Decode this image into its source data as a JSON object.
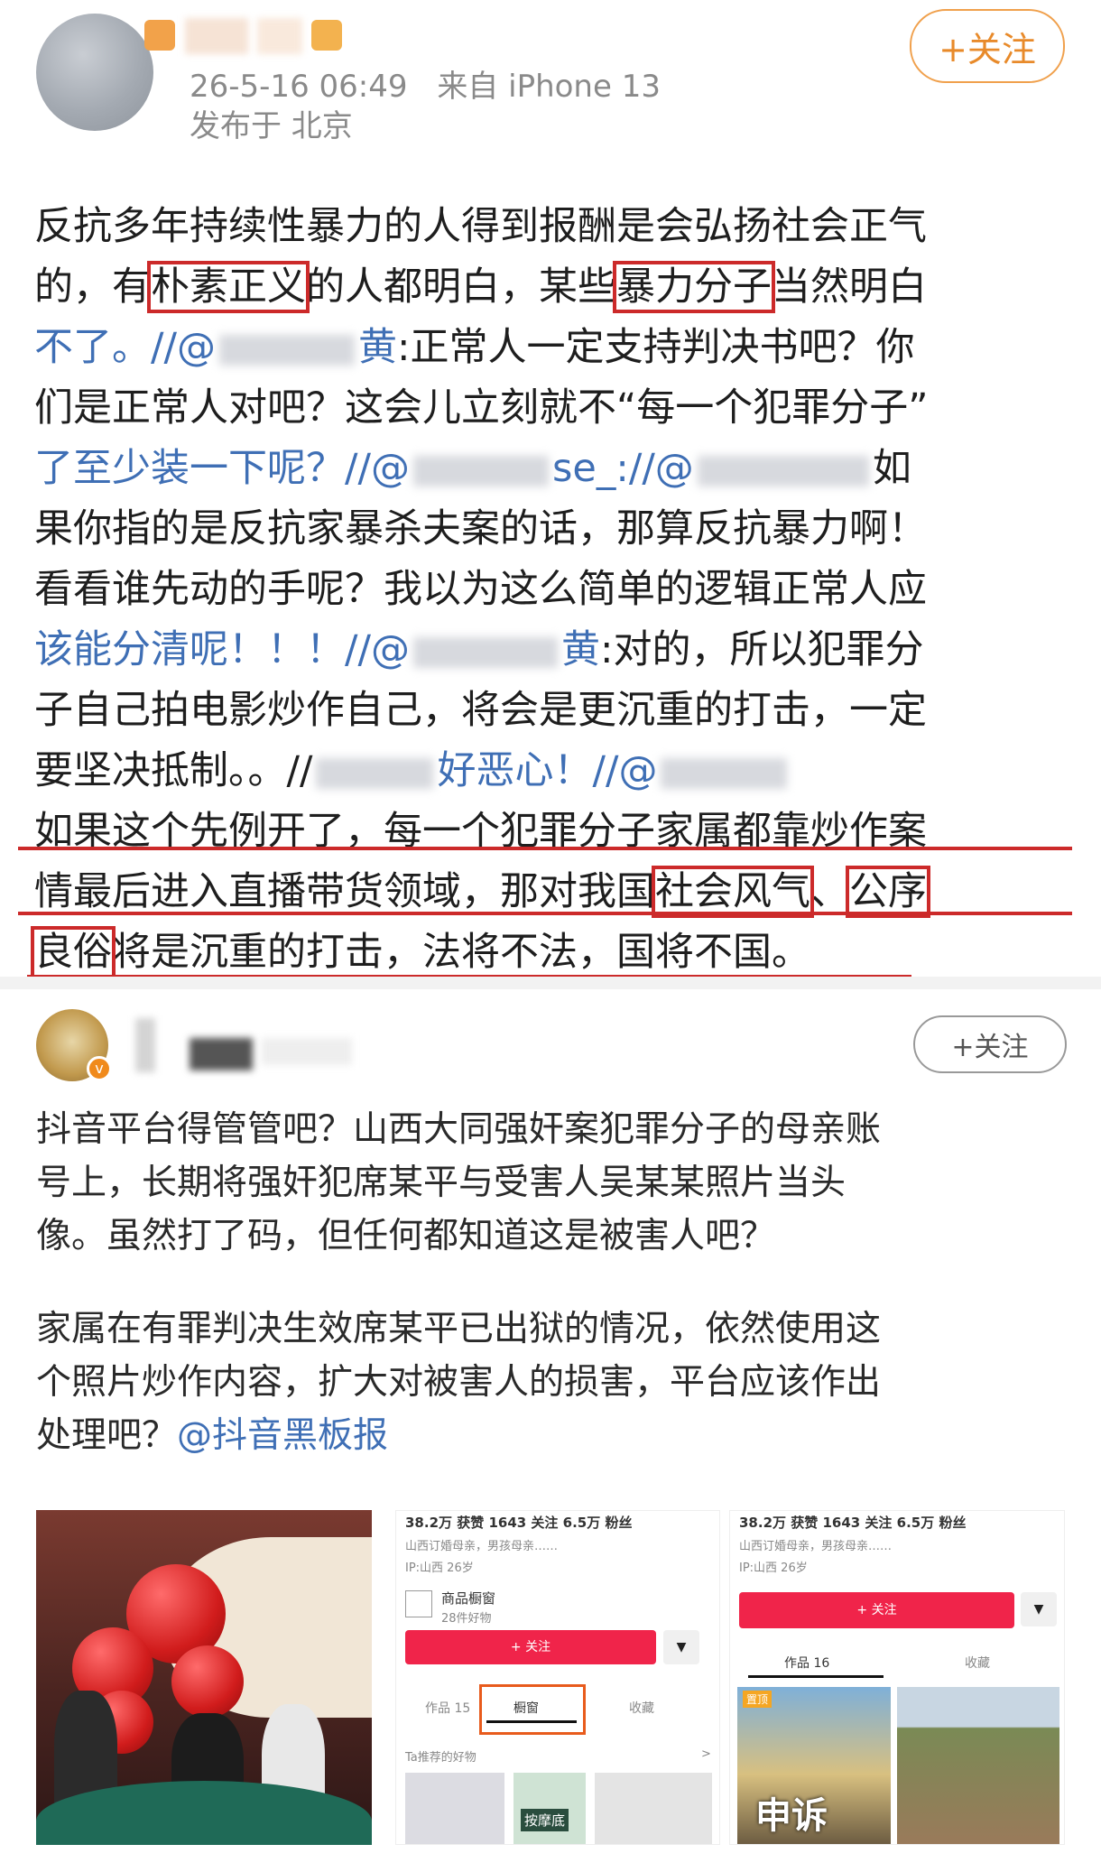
{
  "post1": {
    "timestamp": "26-5-16 06:49",
    "source": "来自 iPhone 13",
    "location": "发布于 北京",
    "follow_label": "+关注",
    "lines": {
      "l1": "反抗多年持续性暴力的人得到报酬是会弘扬社会正气",
      "l2a": "的，有",
      "l2b": "朴素正义",
      "l2c": "的人都明白，某些",
      "l2d": "暴力分子",
      "l2e": "当然明白",
      "l3a": "不了。//@",
      "l3b": "黄",
      "l3c": ":正常人一定支持判决书吧？你",
      "l4": "们是正常人对吧？这会儿立刻就不“每一个犯罪分子”",
      "l5a": "了至少装一下呢？//@",
      "l5b": "se_",
      "l5c": "://@",
      "l5d": "如",
      "l6": "果你指的是反抗家暴杀夫案的话，那算反抗暴力啊！",
      "l7": "看看谁先动的手呢？我以为这么简单的逻辑正常人应",
      "l8a": "该能分清呢！！！//@",
      "l8b": "黄",
      "l8c": ":对的，所以犯罪分",
      "l9": "子自己拍电影炒作自己，将会是更沉重的打击，一定",
      "l10a": "要坚决抵制。。//",
      "l10b": "好恶心！//@",
      "l11": "如果这个先例开了，每一个犯罪分子家属都靠炒作案",
      "l12a": "情最后进入直播带货领域，那对我国",
      "l12b": "社会风气",
      "l12c": "、",
      "l12d": "公序",
      "l13a": "良俗",
      "l13b": "将是沉重的打击，法将不法，国将不国。"
    }
  },
  "post2": {
    "follow_label": "+关注",
    "verified_mark": "v",
    "p1": [
      "抖音平台得管管吧？山西大同强奸案犯罪分子的母亲账",
      "号上，长期将强奸犯席某平与受害人吴某某照片当头",
      "像。虽然打了码，但任何都知道这是被害人吧？"
    ],
    "p2": [
      "家属在有罪判决生效席某平已出狱的情况，依然使用这",
      "个照片炒作内容，扩大对被害人的损害，平台应该作出"
    ],
    "p2_last_plain": "处理吧？",
    "p2_last_mention": "@抖音黑板报"
  },
  "screens": {
    "s1": {
      "stats": "38.2万 获赞   1643 关注   6.5万 粉丝",
      "bio": "山西订婚母亲，男孩母亲……",
      "ip": "IP:山西   26岁",
      "shop_title": "商品橱窗",
      "shop_sub": "28件好物",
      "follow": "+ 关注",
      "drop": "▼",
      "tab_works": "作品 15",
      "tab_shop": "橱窗",
      "tab_fav": "收藏",
      "rec": "Ta推荐的好物",
      "rec_arrow": ">",
      "product": "按摩底"
    },
    "s2": {
      "stats": "38.2万 获赞   1643 关注   6.5万 粉丝",
      "bio": "山西订婚母亲，男孩母亲……",
      "ip": "IP:山西   26岁",
      "follow": "+ 关注",
      "drop": "▼",
      "tab_works": "作品 16",
      "tab_fav": "收藏",
      "pin": "置顶",
      "overlay": "申诉"
    }
  }
}
